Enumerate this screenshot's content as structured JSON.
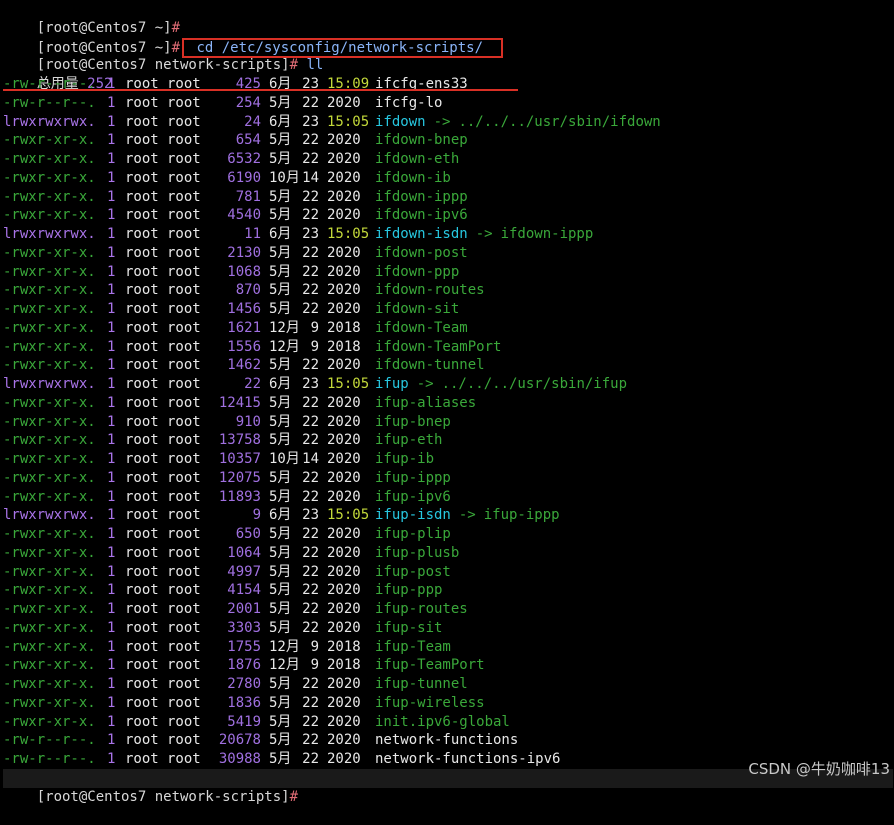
{
  "prompt_prefix": "[root@Centos7 ~]",
  "prompt_dir_prefix": "[root@Centos7 network-scripts]",
  "hash": "#",
  "cmd_cd": " cd /etc/sysconfig/network-scripts/",
  "cmd_ll": " ll",
  "total_label": "总用量",
  "total_value": "252",
  "files": [
    {
      "perm": "-rw-r--r--.",
      "links": "1",
      "owner": "root",
      "group": "root",
      "size": "425",
      "month": "6月",
      "day": "23",
      "time": "15:09",
      "name": "ifcfg-ens33",
      "type": "normal",
      "timeColor": "yellow"
    },
    {
      "perm": "-rw-r--r--.",
      "links": "1",
      "owner": "root",
      "group": "root",
      "size": "254",
      "month": "5月",
      "day": "22",
      "time": "2020",
      "name": "ifcfg-lo",
      "type": "normal"
    },
    {
      "perm": "lrwxrwxrwx.",
      "links": "1",
      "owner": "root",
      "group": "root",
      "size": "24",
      "month": "6月",
      "day": "23",
      "time": "15:05",
      "name": "ifdown",
      "type": "symlink",
      "target": "../../../usr/sbin/ifdown",
      "timeColor": "yellow"
    },
    {
      "perm": "-rwxr-xr-x.",
      "links": "1",
      "owner": "root",
      "group": "root",
      "size": "654",
      "month": "5月",
      "day": "22",
      "time": "2020",
      "name": "ifdown-bnep",
      "type": "exe"
    },
    {
      "perm": "-rwxr-xr-x.",
      "links": "1",
      "owner": "root",
      "group": "root",
      "size": "6532",
      "month": "5月",
      "day": "22",
      "time": "2020",
      "name": "ifdown-eth",
      "type": "exe"
    },
    {
      "perm": "-rwxr-xr-x.",
      "links": "1",
      "owner": "root",
      "group": "root",
      "size": "6190",
      "month": "10月",
      "day": "14",
      "time": "2020",
      "name": "ifdown-ib",
      "type": "exe"
    },
    {
      "perm": "-rwxr-xr-x.",
      "links": "1",
      "owner": "root",
      "group": "root",
      "size": "781",
      "month": "5月",
      "day": "22",
      "time": "2020",
      "name": "ifdown-ippp",
      "type": "exe"
    },
    {
      "perm": "-rwxr-xr-x.",
      "links": "1",
      "owner": "root",
      "group": "root",
      "size": "4540",
      "month": "5月",
      "day": "22",
      "time": "2020",
      "name": "ifdown-ipv6",
      "type": "exe"
    },
    {
      "perm": "lrwxrwxrwx.",
      "links": "1",
      "owner": "root",
      "group": "root",
      "size": "11",
      "month": "6月",
      "day": "23",
      "time": "15:05",
      "name": "ifdown-isdn",
      "type": "symlink",
      "target": "ifdown-ippp",
      "timeColor": "yellow"
    },
    {
      "perm": "-rwxr-xr-x.",
      "links": "1",
      "owner": "root",
      "group": "root",
      "size": "2130",
      "month": "5月",
      "day": "22",
      "time": "2020",
      "name": "ifdown-post",
      "type": "exe"
    },
    {
      "perm": "-rwxr-xr-x.",
      "links": "1",
      "owner": "root",
      "group": "root",
      "size": "1068",
      "month": "5月",
      "day": "22",
      "time": "2020",
      "name": "ifdown-ppp",
      "type": "exe"
    },
    {
      "perm": "-rwxr-xr-x.",
      "links": "1",
      "owner": "root",
      "group": "root",
      "size": "870",
      "month": "5月",
      "day": "22",
      "time": "2020",
      "name": "ifdown-routes",
      "type": "exe"
    },
    {
      "perm": "-rwxr-xr-x.",
      "links": "1",
      "owner": "root",
      "group": "root",
      "size": "1456",
      "month": "5月",
      "day": "22",
      "time": "2020",
      "name": "ifdown-sit",
      "type": "exe"
    },
    {
      "perm": "-rwxr-xr-x.",
      "links": "1",
      "owner": "root",
      "group": "root",
      "size": "1621",
      "month": "12月",
      "day": "9",
      "time": "2018",
      "name": "ifdown-Team",
      "type": "exe"
    },
    {
      "perm": "-rwxr-xr-x.",
      "links": "1",
      "owner": "root",
      "group": "root",
      "size": "1556",
      "month": "12月",
      "day": "9",
      "time": "2018",
      "name": "ifdown-TeamPort",
      "type": "exe"
    },
    {
      "perm": "-rwxr-xr-x.",
      "links": "1",
      "owner": "root",
      "group": "root",
      "size": "1462",
      "month": "5月",
      "day": "22",
      "time": "2020",
      "name": "ifdown-tunnel",
      "type": "exe"
    },
    {
      "perm": "lrwxrwxrwx.",
      "links": "1",
      "owner": "root",
      "group": "root",
      "size": "22",
      "month": "6月",
      "day": "23",
      "time": "15:05",
      "name": "ifup",
      "type": "symlink",
      "target": "../../../usr/sbin/ifup",
      "timeColor": "yellow"
    },
    {
      "perm": "-rwxr-xr-x.",
      "links": "1",
      "owner": "root",
      "group": "root",
      "size": "12415",
      "month": "5月",
      "day": "22",
      "time": "2020",
      "name": "ifup-aliases",
      "type": "exe"
    },
    {
      "perm": "-rwxr-xr-x.",
      "links": "1",
      "owner": "root",
      "group": "root",
      "size": "910",
      "month": "5月",
      "day": "22",
      "time": "2020",
      "name": "ifup-bnep",
      "type": "exe"
    },
    {
      "perm": "-rwxr-xr-x.",
      "links": "1",
      "owner": "root",
      "group": "root",
      "size": "13758",
      "month": "5月",
      "day": "22",
      "time": "2020",
      "name": "ifup-eth",
      "type": "exe"
    },
    {
      "perm": "-rwxr-xr-x.",
      "links": "1",
      "owner": "root",
      "group": "root",
      "size": "10357",
      "month": "10月",
      "day": "14",
      "time": "2020",
      "name": "ifup-ib",
      "type": "exe"
    },
    {
      "perm": "-rwxr-xr-x.",
      "links": "1",
      "owner": "root",
      "group": "root",
      "size": "12075",
      "month": "5月",
      "day": "22",
      "time": "2020",
      "name": "ifup-ippp",
      "type": "exe"
    },
    {
      "perm": "-rwxr-xr-x.",
      "links": "1",
      "owner": "root",
      "group": "root",
      "size": "11893",
      "month": "5月",
      "day": "22",
      "time": "2020",
      "name": "ifup-ipv6",
      "type": "exe"
    },
    {
      "perm": "lrwxrwxrwx.",
      "links": "1",
      "owner": "root",
      "group": "root",
      "size": "9",
      "month": "6月",
      "day": "23",
      "time": "15:05",
      "name": "ifup-isdn",
      "type": "symlink",
      "target": "ifup-ippp",
      "timeColor": "yellow"
    },
    {
      "perm": "-rwxr-xr-x.",
      "links": "1",
      "owner": "root",
      "group": "root",
      "size": "650",
      "month": "5月",
      "day": "22",
      "time": "2020",
      "name": "ifup-plip",
      "type": "exe"
    },
    {
      "perm": "-rwxr-xr-x.",
      "links": "1",
      "owner": "root",
      "group": "root",
      "size": "1064",
      "month": "5月",
      "day": "22",
      "time": "2020",
      "name": "ifup-plusb",
      "type": "exe"
    },
    {
      "perm": "-rwxr-xr-x.",
      "links": "1",
      "owner": "root",
      "group": "root",
      "size": "4997",
      "month": "5月",
      "day": "22",
      "time": "2020",
      "name": "ifup-post",
      "type": "exe"
    },
    {
      "perm": "-rwxr-xr-x.",
      "links": "1",
      "owner": "root",
      "group": "root",
      "size": "4154",
      "month": "5月",
      "day": "22",
      "time": "2020",
      "name": "ifup-ppp",
      "type": "exe"
    },
    {
      "perm": "-rwxr-xr-x.",
      "links": "1",
      "owner": "root",
      "group": "root",
      "size": "2001",
      "month": "5月",
      "day": "22",
      "time": "2020",
      "name": "ifup-routes",
      "type": "exe"
    },
    {
      "perm": "-rwxr-xr-x.",
      "links": "1",
      "owner": "root",
      "group": "root",
      "size": "3303",
      "month": "5月",
      "day": "22",
      "time": "2020",
      "name": "ifup-sit",
      "type": "exe"
    },
    {
      "perm": "-rwxr-xr-x.",
      "links": "1",
      "owner": "root",
      "group": "root",
      "size": "1755",
      "month": "12月",
      "day": "9",
      "time": "2018",
      "name": "ifup-Team",
      "type": "exe"
    },
    {
      "perm": "-rwxr-xr-x.",
      "links": "1",
      "owner": "root",
      "group": "root",
      "size": "1876",
      "month": "12月",
      "day": "9",
      "time": "2018",
      "name": "ifup-TeamPort",
      "type": "exe"
    },
    {
      "perm": "-rwxr-xr-x.",
      "links": "1",
      "owner": "root",
      "group": "root",
      "size": "2780",
      "month": "5月",
      "day": "22",
      "time": "2020",
      "name": "ifup-tunnel",
      "type": "exe"
    },
    {
      "perm": "-rwxr-xr-x.",
      "links": "1",
      "owner": "root",
      "group": "root",
      "size": "1836",
      "month": "5月",
      "day": "22",
      "time": "2020",
      "name": "ifup-wireless",
      "type": "exe"
    },
    {
      "perm": "-rwxr-xr-x.",
      "links": "1",
      "owner": "root",
      "group": "root",
      "size": "5419",
      "month": "5月",
      "day": "22",
      "time": "2020",
      "name": "init.ipv6-global",
      "type": "exe"
    },
    {
      "perm": "-rw-r--r--.",
      "links": "1",
      "owner": "root",
      "group": "root",
      "size": "20678",
      "month": "5月",
      "day": "22",
      "time": "2020",
      "name": "network-functions",
      "type": "normal"
    },
    {
      "perm": "-rw-r--r--.",
      "links": "1",
      "owner": "root",
      "group": "root",
      "size": "30988",
      "month": "5月",
      "day": "22",
      "time": "2020",
      "name": "network-functions-ipv6",
      "type": "normal"
    }
  ],
  "arrow": "->",
  "watermark": "CSDN @牛奶咖啡13",
  "colors": {
    "background": "#000000",
    "highlight_box": "#d93025",
    "perm_green": "#3aa83a",
    "size_purple": "#a070e0",
    "time_yellow": "#c3d93a",
    "symlink_cyan": "#27c7e0"
  }
}
